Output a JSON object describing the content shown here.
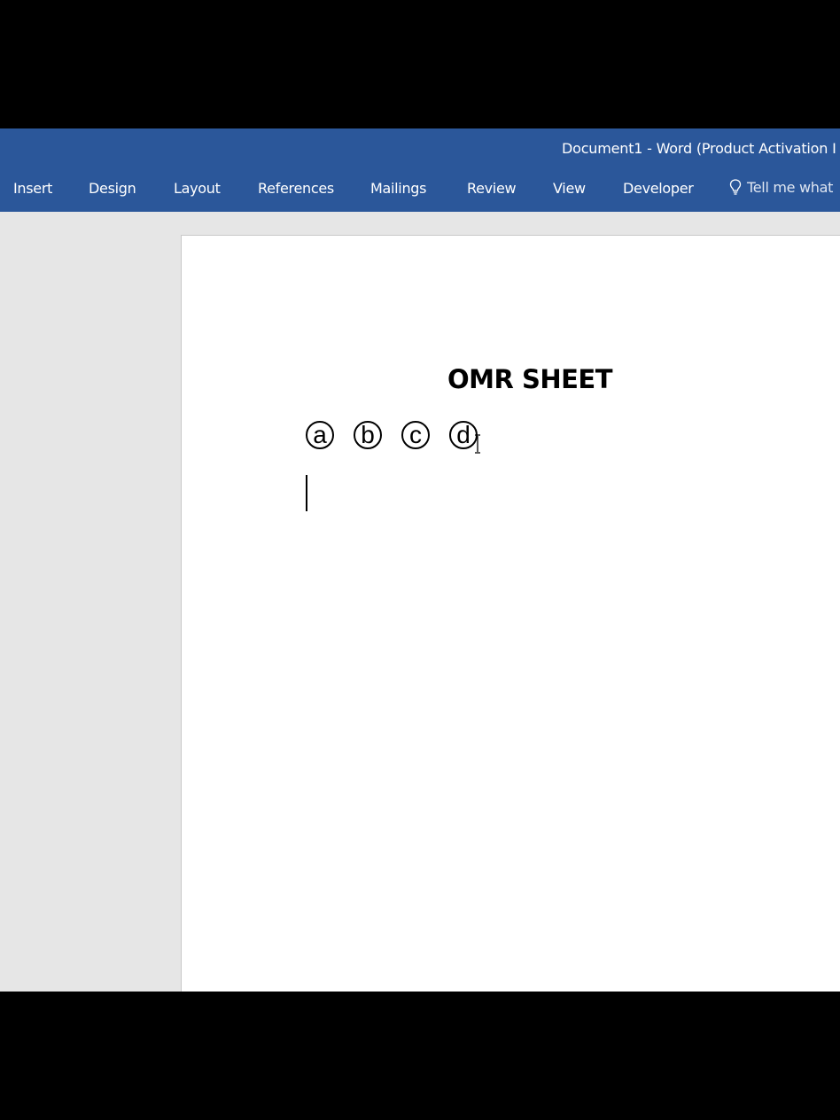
{
  "window": {
    "title": "Document1 - Word (Product Activation I"
  },
  "ribbon": {
    "tabs": [
      {
        "label": "Insert"
      },
      {
        "label": "Design"
      },
      {
        "label": "Layout"
      },
      {
        "label": "References"
      },
      {
        "label": "Mailings"
      },
      {
        "label": "Review"
      },
      {
        "label": "View"
      },
      {
        "label": "Developer"
      }
    ],
    "tell_me": "Tell me what"
  },
  "document": {
    "title": "OMR SHEET",
    "options": [
      "a",
      "b",
      "c",
      "d"
    ]
  },
  "colors": {
    "ribbon": "#2b579a",
    "workspace": "#e6e6e6",
    "page": "#ffffff"
  },
  "icons": [
    "lightbulb-icon",
    "text-cursor-icon"
  ]
}
